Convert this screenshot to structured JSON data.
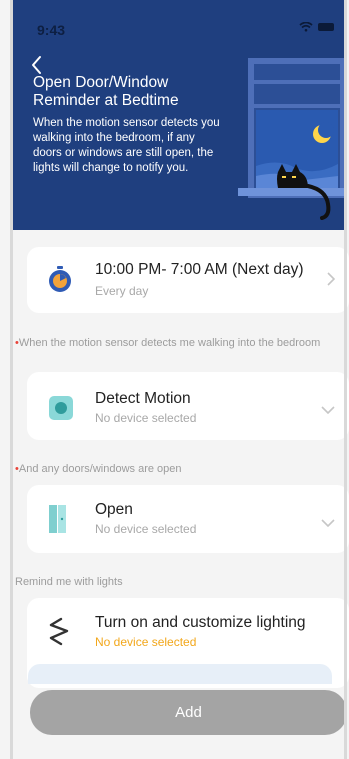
{
  "status": {
    "time": "9:43"
  },
  "hero": {
    "title": "Open Door/Window Reminder at Bedtime",
    "description": "When the motion sensor detects you walking into the bedroom, if any doors or windows are still open, the lights will change to notify you."
  },
  "schedule": {
    "time_range": "10:00 PM- 7:00 AM (Next day)",
    "repeat": "Every day"
  },
  "motion": {
    "section_label": "When the motion sensor detects me walking into the bedroom",
    "title": "Detect Motion",
    "device": "No device selected"
  },
  "open": {
    "section_label": "And any doors/windows are open",
    "title": "Open",
    "device": "No device selected"
  },
  "lights": {
    "section_label": "Remind me with lights",
    "title": "Turn on and customize lighting",
    "device": "No device selected"
  },
  "footer": {
    "add_label": "Add"
  },
  "colors": {
    "hero_bg": "#1f3f7f",
    "accent_blue": "#0b5bd6",
    "warning": "#f2a71b",
    "required": "#e8443a"
  }
}
